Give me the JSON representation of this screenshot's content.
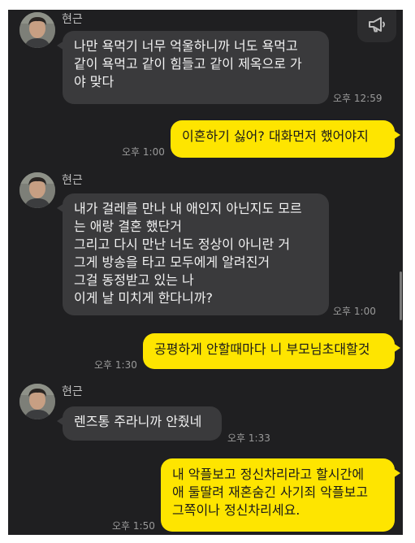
{
  "colors": {
    "background": "#1f1f21",
    "incoming_bubble": "#3a3a3c",
    "outgoing_bubble": "#fee500",
    "time_text": "#9a9a9a"
  },
  "toolbar": {
    "notice_icon": "megaphone-icon"
  },
  "messages": [
    {
      "direction": "incoming",
      "sender": "현근",
      "text": "나만 욕먹기 너무 억울하니까 너도 욕먹고\n같이 욕먹고 같이 힘들고 같이 제옥으로 가\n야 맞다",
      "time": "오후 12:59"
    },
    {
      "direction": "outgoing",
      "text": "이혼하기 싫어? 대화먼저 했어야지",
      "time": "오후 1:00"
    },
    {
      "direction": "incoming",
      "sender": "현근",
      "text": "내가 걸레를 만나 내 애인지 아닌지도 모르\n는 애랑 결혼 했단거\n그리고 다시 만난 너도 정상이 아니란 거\n그게 방송을 타고 모두에게 알려진거\n그걸 동정받고 있는 나\n이게 날 미치게 한다니까?",
      "time": "오후 1:00"
    },
    {
      "direction": "outgoing",
      "text": "공평하게 안할때마다 니 부모님초대할것",
      "time": "오후 1:30"
    },
    {
      "direction": "incoming",
      "sender": "현근",
      "text": "렌즈통 주라니까 안줬네",
      "time": "오후 1:33"
    },
    {
      "direction": "outgoing",
      "text": "내 악플보고 정신차리라고 할시간에\n애 둘딸려 재혼숨긴 사기죄 악플보고\n그쪽이나 정신차리세요.",
      "time": "오후 1:50"
    }
  ]
}
